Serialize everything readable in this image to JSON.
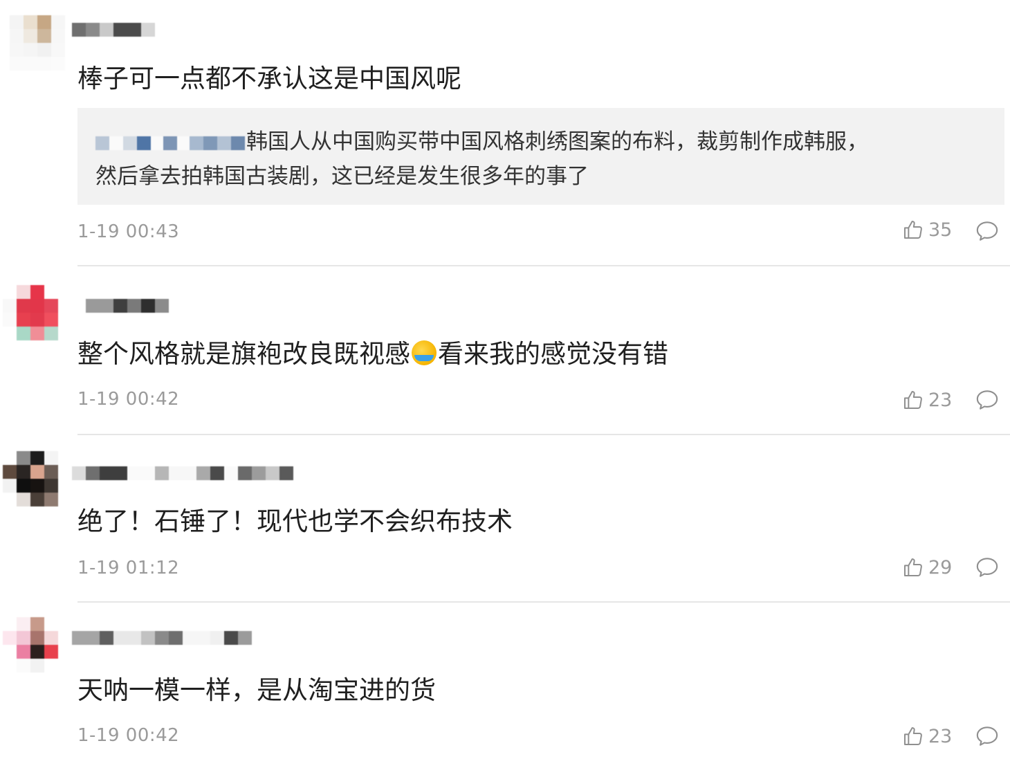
{
  "comments": [
    {
      "text": "棒子可一点都不承认这是中国风呢",
      "quote": {
        "text": "韩国人从中国购买带中国风格刺绣图案的布料，裁剪制作成韩服，",
        "line2": "然后拿去拍韩国古装剧，这已经是发生很多年的事了"
      },
      "time": "1-19 00:43",
      "likes": "35"
    },
    {
      "text_before": "整个风格就是旗袍改良既视感",
      "text_after": "看来我的感觉没有错",
      "time": "1-19 00:42",
      "likes": "23"
    },
    {
      "text": "绝了！石锤了！现代也学不会织布技术",
      "time": "1-19 01:12",
      "likes": "29"
    },
    {
      "text": "天呐一模一样，是从淘宝进的货",
      "time": "1-19 00:42",
      "likes": "23"
    }
  ],
  "icons": {
    "like": "thumbs-up-icon",
    "reply": "comment-bubble-icon",
    "emoji": "crying-laughing-emoji"
  },
  "colors": {
    "meta": "#9a9a9a",
    "quote_bg": "#f2f2f2",
    "divider": "#e6e6e6"
  }
}
